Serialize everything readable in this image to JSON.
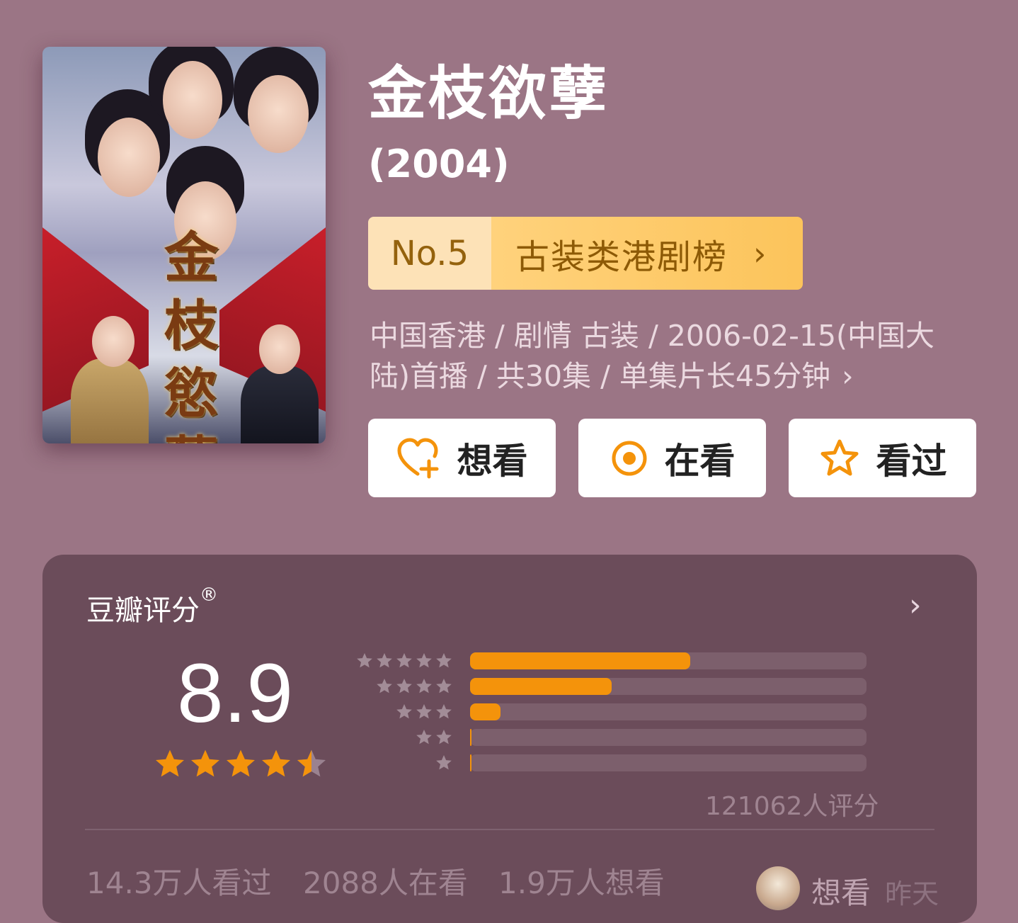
{
  "poster": {
    "calligraphy": [
      "金",
      "枝",
      "慾",
      "孽"
    ]
  },
  "title": "金枝欲孽",
  "year": "(2004)",
  "ranking": {
    "no": "No.5",
    "name": "古装类港剧榜",
    "chevron": "›"
  },
  "meta": {
    "line1": "中国香港 / 剧情 古装 / 2006-02-15(中国大",
    "line2": "陆)首播 / 共30集 / 单集片长45分钟",
    "chevron": "›"
  },
  "actions": {
    "want": {
      "label": "想看",
      "icon": "heart-plus-icon"
    },
    "watching": {
      "label": "在看",
      "icon": "target-circle-icon"
    },
    "watched": {
      "label": "看过",
      "icon": "star-outline-icon"
    }
  },
  "rating": {
    "title": "豆瓣评分",
    "registered": "®",
    "chevron": "›",
    "score": "8.9",
    "stars": 4.5,
    "count": "121062人评分",
    "distribution": [
      {
        "stars": 5,
        "fraction": 0.555
      },
      {
        "stars": 4,
        "fraction": 0.357
      },
      {
        "stars": 3,
        "fraction": 0.076
      },
      {
        "stars": 2,
        "fraction": 0.004
      },
      {
        "stars": 1,
        "fraction": 0.002
      }
    ],
    "stats": {
      "watched": "14.3万人看过",
      "watching": "2088人在看",
      "want": "1.9万人想看"
    },
    "recent": {
      "label": "想看",
      "time": "昨天"
    }
  },
  "colors": {
    "background": "#9b7585",
    "card": "#6b4c5a",
    "accent": "#f4930b",
    "rank_tag": "#fcc45b"
  }
}
